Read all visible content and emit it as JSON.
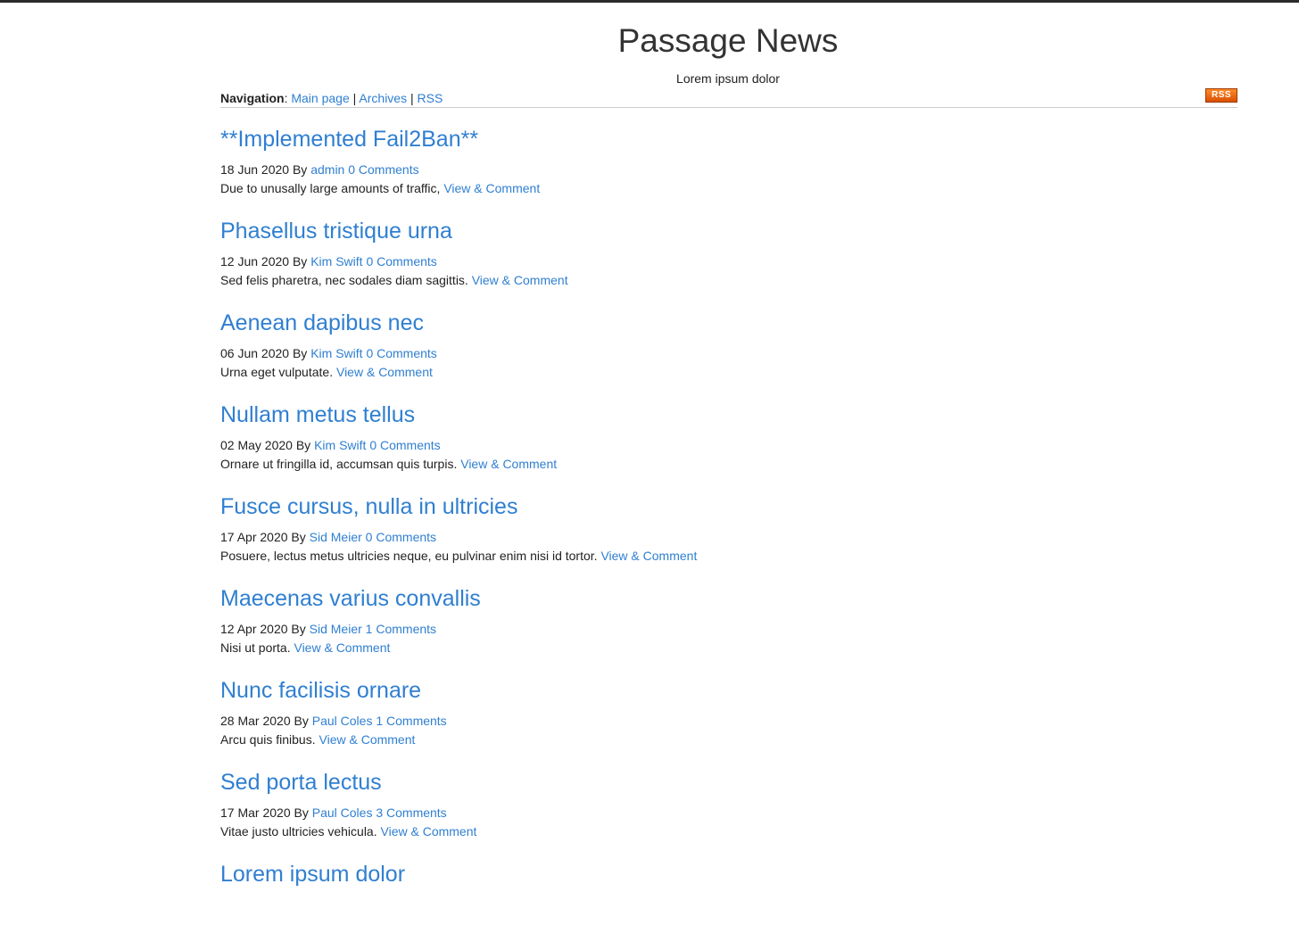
{
  "site": {
    "title": "Passage News",
    "subtitle": "Lorem ipsum dolor"
  },
  "nav": {
    "label": "Navigation",
    "links": [
      "Main page",
      "Archives",
      "RSS"
    ],
    "rss_badge": "RSS"
  },
  "posts": [
    {
      "title": "**Implemented Fail2Ban**",
      "date": "18 Jun 2020",
      "by": "By",
      "author": "admin",
      "comments": "0 Comments",
      "excerpt": "Due to unusally large amounts of traffic,",
      "link": "View & Comment"
    },
    {
      "title": "Phasellus tristique urna",
      "date": "12 Jun 2020",
      "by": "By",
      "author": "Kim Swift",
      "comments": "0 Comments",
      "excerpt": "Sed felis pharetra, nec sodales diam sagittis.",
      "link": "View & Comment"
    },
    {
      "title": "Aenean dapibus nec",
      "date": "06 Jun 2020",
      "by": "By",
      "author": "Kim Swift",
      "comments": "0 Comments",
      "excerpt": "Urna eget vulputate.",
      "link": "View & Comment"
    },
    {
      "title": "Nullam metus tellus",
      "date": "02 May 2020",
      "by": "By",
      "author": "Kim Swift",
      "comments": "0 Comments",
      "excerpt": "Ornare ut fringilla id, accumsan quis turpis.",
      "link": "View & Comment"
    },
    {
      "title": "Fusce cursus, nulla in ultricies",
      "date": "17 Apr 2020",
      "by": "By",
      "author": "Sid Meier",
      "comments": "0 Comments",
      "excerpt": "Posuere, lectus metus ultricies neque, eu pulvinar enim nisi id tortor.",
      "link": "View & Comment"
    },
    {
      "title": "Maecenas varius convallis",
      "date": "12 Apr 2020",
      "by": "By",
      "author": "Sid Meier",
      "comments": "1 Comments",
      "excerpt": "Nisi ut porta.",
      "link": "View & Comment"
    },
    {
      "title": "Nunc facilisis ornare",
      "date": "28 Mar 2020",
      "by": "By",
      "author": "Paul Coles",
      "comments": "1 Comments",
      "excerpt": "Arcu quis finibus.",
      "link": "View & Comment"
    },
    {
      "title": "Sed porta lectus",
      "date": "17 Mar 2020",
      "by": "By",
      "author": "Paul Coles",
      "comments": "3 Comments",
      "excerpt": "Vitae justo ultricies vehicula.",
      "link": "View & Comment"
    },
    {
      "title": "Lorem ipsum dolor",
      "date": "",
      "by": "",
      "author": "",
      "comments": "",
      "excerpt": "",
      "link": ""
    }
  ],
  "colors": {
    "link": "#2f7fd1",
    "text": "#222222",
    "rss": "#ff6600"
  }
}
